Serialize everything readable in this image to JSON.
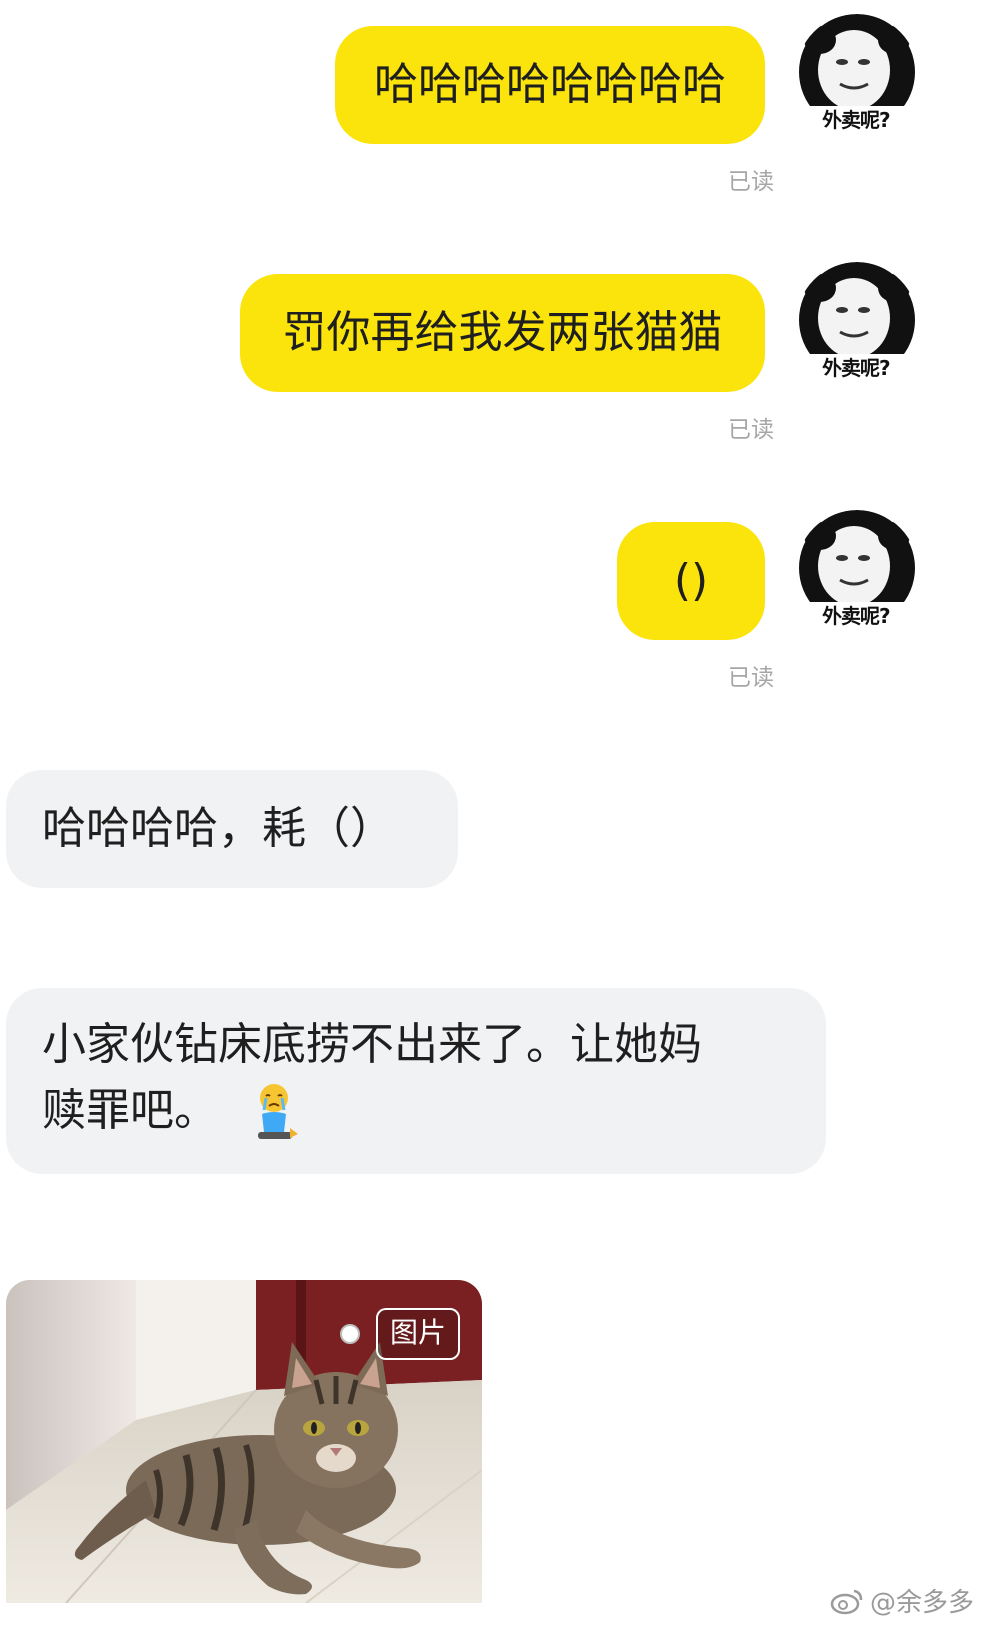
{
  "messages_out": [
    {
      "text": "哈哈哈哈哈哈哈哈",
      "status": "已读"
    },
    {
      "text": "罚你再给我发两张猫猫",
      "status": "已读"
    },
    {
      "text": "()",
      "status": "已读"
    }
  ],
  "avatar": {
    "caption": "外卖呢?",
    "icon": "panda-meme-avatar-icon"
  },
  "messages_in": [
    {
      "text": "哈哈哈哈，耗（）"
    },
    {
      "line1": "小家伙钻床底捞不出来了。让她妈",
      "line2": "赎罪吧。",
      "emoji": "crying-kneeling-emoji-icon"
    }
  ],
  "photo_message": {
    "tag": "图片",
    "subject": "tabby-cat-photo"
  },
  "watermark": {
    "text": "@余多多",
    "icon": "weibo-logo-icon"
  },
  "colors": {
    "outgoing_bubble": "#fbe40c",
    "incoming_bubble": "#f1f2f4",
    "read_status": "#a6a6a6"
  }
}
